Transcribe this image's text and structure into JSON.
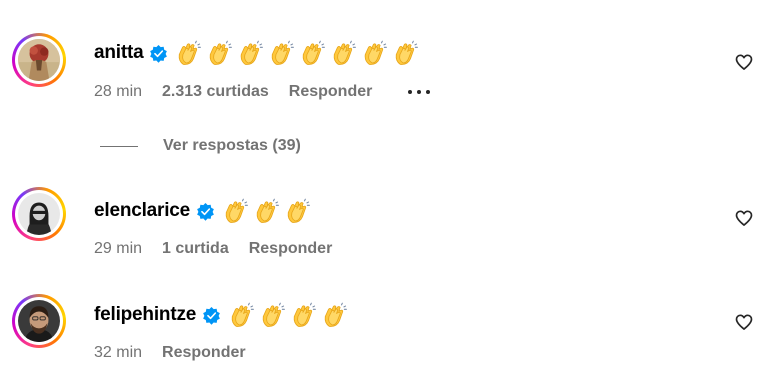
{
  "comments": [
    {
      "username": "anitta",
      "verified": true,
      "emoji_count": 8,
      "time": "28 min",
      "likes": "2.313 curtidas",
      "reply_label": "Responder",
      "has_more": true,
      "avatar_colors": [
        "#c9b48a",
        "#a83a2e"
      ]
    },
    {
      "username": "elenclarice",
      "verified": true,
      "emoji_count": 3,
      "time": "29 min",
      "likes": "1 curtida",
      "reply_label": "Responder",
      "has_more": false,
      "avatar_colors": [
        "#e8e8e8",
        "#2a2a2a"
      ]
    },
    {
      "username": "felipehintze",
      "verified": true,
      "emoji_count": 4,
      "time": "32 min",
      "likes": "",
      "reply_label": "Responder",
      "has_more": false,
      "avatar_colors": [
        "#3a3a3a",
        "#c59a7a"
      ]
    }
  ],
  "view_replies": {
    "label": "Ver respostas (39)"
  },
  "colors": {
    "muted_text": "#737373",
    "verified_blue": "#0095f6",
    "clap_yellow": "#ffc83d"
  },
  "icons": {
    "verified": "verified-badge-icon",
    "clap": "clapping-hands-emoji",
    "like": "heart-outline-icon",
    "more": "more-options-icon"
  }
}
